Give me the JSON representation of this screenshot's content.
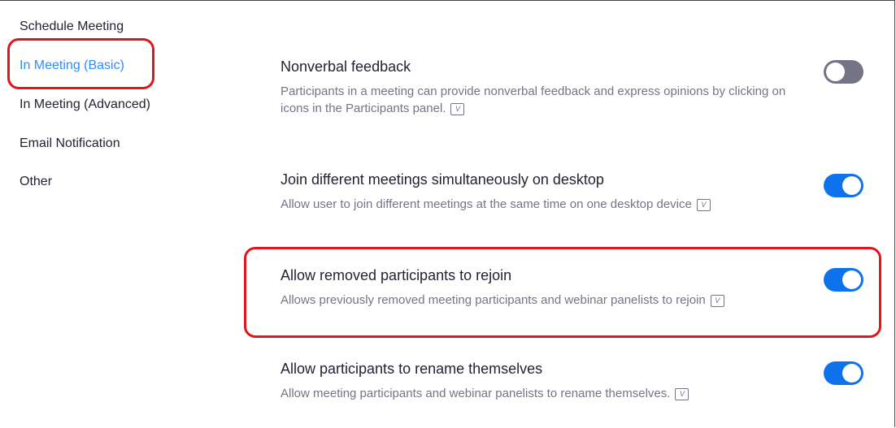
{
  "sidebar": {
    "items": [
      {
        "label": "Schedule Meeting"
      },
      {
        "label": "In Meeting (Basic)"
      },
      {
        "label": "In Meeting (Advanced)"
      },
      {
        "label": "Email Notification"
      },
      {
        "label": "Other"
      }
    ],
    "active_index": 1
  },
  "settings": [
    {
      "title": "Nonverbal feedback",
      "description": "Participants in a meeting can provide nonverbal feedback and express opinions by clicking on icons in the Participants panel.",
      "enabled": false
    },
    {
      "title": "Join different meetings simultaneously on desktop",
      "description": "Allow user to join different meetings at the same time on one desktop device",
      "enabled": true
    },
    {
      "title": "Allow removed participants to rejoin",
      "description": "Allows previously removed meeting participants and webinar panelists to rejoin",
      "enabled": true
    },
    {
      "title": "Allow participants to rename themselves",
      "description": "Allow meeting participants and webinar panelists to rename themselves.",
      "enabled": true
    }
  ],
  "icons": {
    "info_icon": "v-icon"
  },
  "colors": {
    "accent": "#2d8cff",
    "toggle_on": "#0e72ed",
    "toggle_off": "#747487",
    "highlight": "#e0161f",
    "text": "#232333",
    "muted_text": "#747487"
  }
}
